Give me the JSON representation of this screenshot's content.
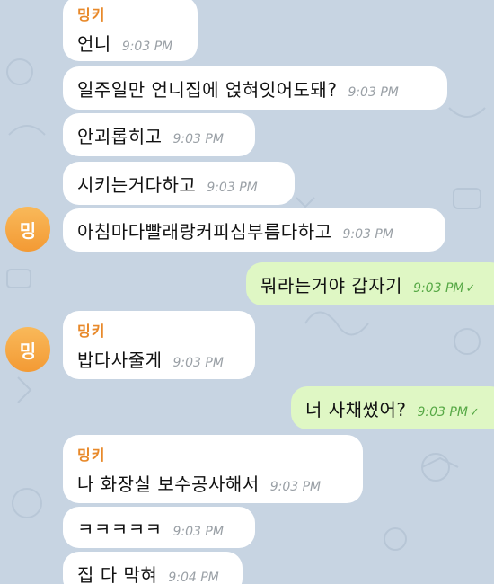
{
  "chat": {
    "sender_name": "밍키",
    "avatar_initial": "밍",
    "messages": [
      {
        "text": "언니",
        "time": "9:03 PM"
      },
      {
        "text": "일주일만 언니집에 얹혀잇어도돼?",
        "time": "9:03 PM"
      },
      {
        "text": "안괴롭히고",
        "time": "9:03 PM"
      },
      {
        "text": "시키는거다하고",
        "time": "9:03 PM"
      },
      {
        "text": "아침마다빨래랑커피심부름다하고",
        "time": "9:03 PM"
      },
      {
        "text": "뭐라는거야 갑자기",
        "time": "9:03 PM"
      },
      {
        "text": "밥다사줄게",
        "time": "9:03 PM"
      },
      {
        "text": "너 사채썼어?",
        "time": "9:03 PM"
      },
      {
        "text": "나 화장실 보수공사해서",
        "time": "9:03 PM"
      },
      {
        "text": "ㅋㅋㅋㅋㅋ",
        "time": "9:03 PM"
      },
      {
        "text": "집 다 막혀",
        "time": "9:04 PM"
      }
    ]
  },
  "colors": {
    "background": "#c7d4e2",
    "incoming_bubble": "#ffffff",
    "outgoing_bubble": "#dff7c4",
    "sender_name": "#e8892a",
    "avatar": "#f39a34",
    "outgoing_time": "#56a845"
  },
  "icons": {
    "read_receipt": "double-check-icon"
  }
}
